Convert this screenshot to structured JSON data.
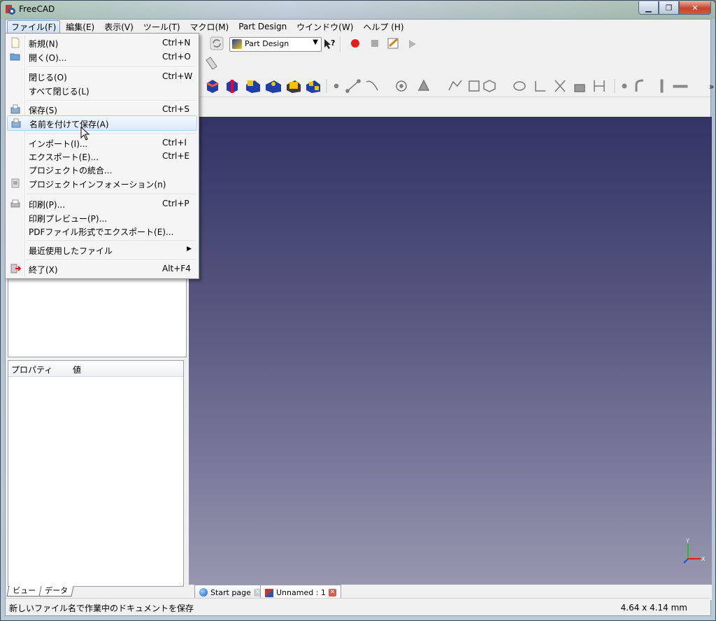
{
  "window": {
    "title": "FreeCAD"
  },
  "menubar": {
    "items": [
      "ファイル(F)",
      "編集(E)",
      "表示(V)",
      "ツール(T)",
      "マクロ(M)",
      "Part Design",
      "ウインドウ(W)",
      "ヘルプ (H)"
    ]
  },
  "toolbar": {
    "workbench_selected": "Part Design"
  },
  "file_menu": {
    "items": [
      {
        "label": "新規(N)",
        "shortcut": "Ctrl+N",
        "icon": "new-file-icon"
      },
      {
        "label": "開く(O)...",
        "shortcut": "Ctrl+O",
        "icon": "open-folder-icon"
      },
      {
        "label": "閉じる(O)",
        "shortcut": "Ctrl+W",
        "icon": ""
      },
      {
        "label": "すべて閉じる(L)",
        "shortcut": "",
        "icon": ""
      },
      {
        "label": "保存(S)",
        "shortcut": "Ctrl+S",
        "icon": "save-icon"
      },
      {
        "label": "名前を付けて保存(A)",
        "shortcut": "",
        "icon": "save-as-icon"
      },
      {
        "label": "インポート(I)...",
        "shortcut": "Ctrl+I",
        "icon": ""
      },
      {
        "label": "エクスポート(E)...",
        "shortcut": "Ctrl+E",
        "icon": ""
      },
      {
        "label": "プロジェクトの統合...",
        "shortcut": "",
        "icon": ""
      },
      {
        "label": "プロジェクトインフォメーション(n)",
        "shortcut": "",
        "icon": "project-info-icon"
      },
      {
        "label": "印刷(P)...",
        "shortcut": "Ctrl+P",
        "icon": "print-icon"
      },
      {
        "label": "印刷プレビュー(P)...",
        "shortcut": "",
        "icon": ""
      },
      {
        "label": "PDFファイル形式でエクスポート(E)...",
        "shortcut": "",
        "icon": ""
      },
      {
        "label": "最近使用したファイル",
        "shortcut": "",
        "icon": ""
      },
      {
        "label": "終了(X)",
        "shortcut": "Alt+F4",
        "icon": "exit-icon"
      }
    ]
  },
  "properties": {
    "col_property": "プロパティ",
    "col_value": "値"
  },
  "left_tabs": [
    "ビュー",
    "データ"
  ],
  "doc_tabs": [
    {
      "label": "Start page"
    },
    {
      "label": "Unnamed : 1"
    }
  ],
  "axis": {
    "y": "Y",
    "x": "X"
  },
  "status": {
    "message": "新しいファイル名で作業中のドキュメントを保存",
    "dimensions": "4.64 x 4.14 mm"
  }
}
